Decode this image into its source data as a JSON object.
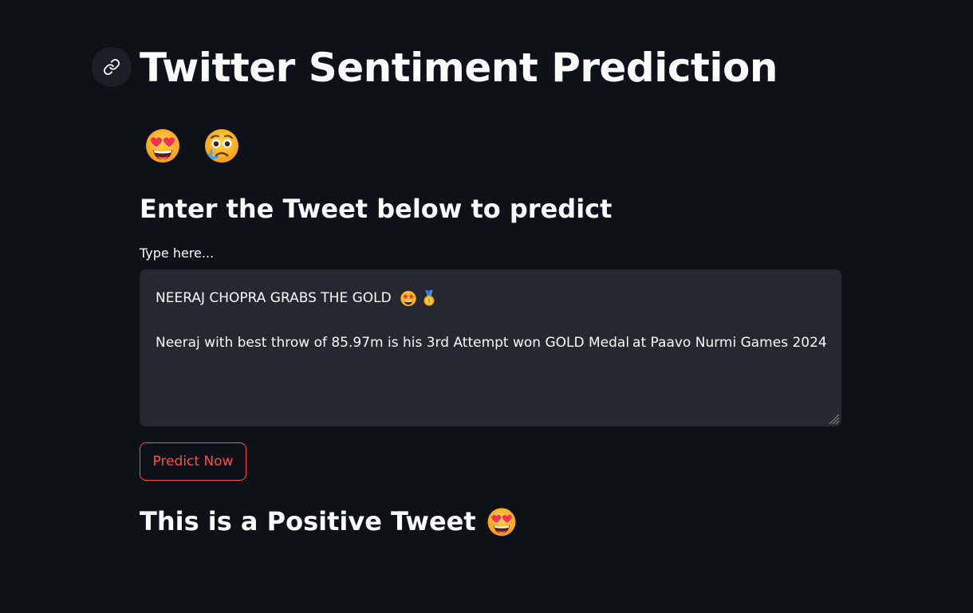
{
  "header": {
    "title": "Twitter Sentiment Prediction",
    "anchor_icon": "link-icon"
  },
  "emojis": [
    "heart-eyes-icon",
    "crying-face-icon"
  ],
  "subheader": "Enter the Tweet below to predict",
  "input": {
    "label": "Type here...",
    "line1": "NEERAJ CHOPRA GRABS THE GOLD",
    "line2_part1": "Neeraj with best throw of 85.97m is his 3rd Attempt won GOLD Medal",
    "line2_part2": "at Paavo Nurmi Games 2024"
  },
  "predict_button_label": "Predict Now",
  "result_text": "This is a Positive Tweet",
  "colors": {
    "background": "#0e1117",
    "input_bg": "#262730",
    "accent": "#ff4b4b",
    "text": "#fafafa"
  }
}
